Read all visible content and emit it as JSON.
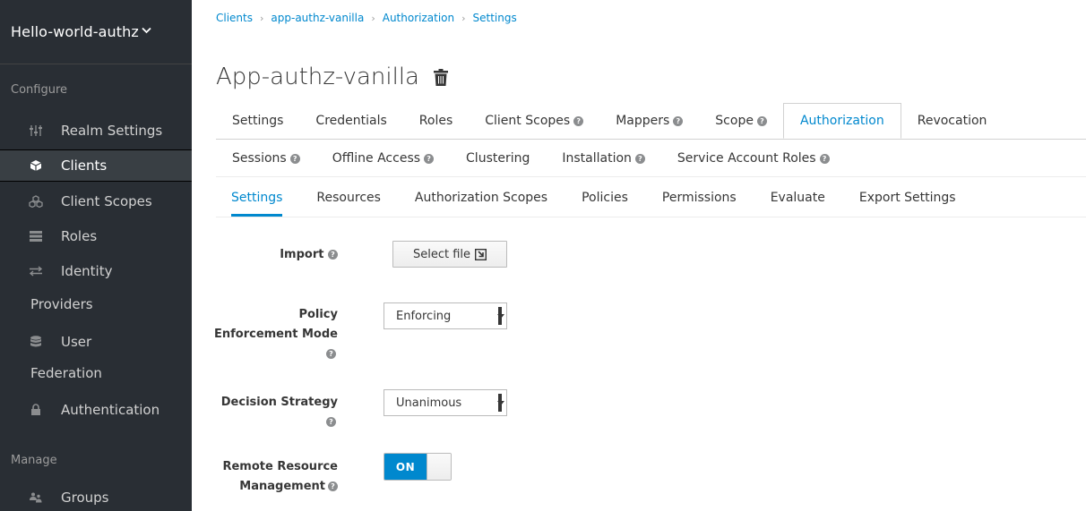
{
  "realm": {
    "name": "Hello-world-authz",
    "caret": "⌄"
  },
  "sidebar": {
    "configure_header": "Configure",
    "manage_header": "Manage",
    "items": [
      {
        "label": "Realm Settings",
        "icon": "sliders-icon"
      },
      {
        "label": "Clients",
        "icon": "cube-icon"
      },
      {
        "label": "Client Scopes",
        "icon": "cubes-icon"
      },
      {
        "label": "Roles",
        "icon": "list-icon"
      },
      {
        "label": "Identity",
        "label2": "Providers",
        "icon": "exchange-icon"
      },
      {
        "label": "User",
        "label2": "Federation",
        "icon": "database-icon"
      },
      {
        "label": "Authentication",
        "icon": "lock-icon"
      },
      {
        "label": "Groups",
        "icon": "users-icon"
      }
    ]
  },
  "breadcrumb": [
    "Clients",
    "app-authz-vanilla",
    "Authorization",
    "Settings"
  ],
  "breadcrumb_sep": "›",
  "page_title": "App-authz-vanilla",
  "tabs_row1": [
    "Settings",
    "Credentials",
    "Roles",
    "Client Scopes",
    "Mappers",
    "Scope",
    "Authorization",
    "Revocation"
  ],
  "tabs_row2": [
    "Sessions",
    "Offline Access",
    "Clustering",
    "Installation",
    "Service Account Roles"
  ],
  "subtabs": [
    "Settings",
    "Resources",
    "Authorization Scopes",
    "Policies",
    "Permissions",
    "Evaluate",
    "Export Settings"
  ],
  "form": {
    "import_label": "Import",
    "select_file": "Select file",
    "policy_label_1": "Policy",
    "policy_label_2": "Enforcement Mode",
    "policy_value": "Enforcing",
    "decision_label": "Decision Strategy",
    "decision_value": "Unanimous",
    "remote_label_1": "Remote Resource",
    "remote_label_2": "Management",
    "remote_toggle": "ON",
    "help_glyph": "?"
  },
  "colors": {
    "accent": "#0088ce",
    "sidebar": "#292e34",
    "sidebar_active": "#393f44"
  }
}
